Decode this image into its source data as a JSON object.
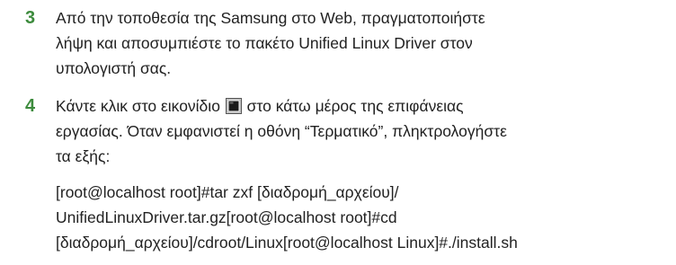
{
  "steps": [
    {
      "number": "3",
      "lines": [
        "Από την τοποθεσία της Samsung στο Web, πραγματοποιήστε",
        "λήψη και αποσυμπιέστε το πακέτο Unified Linux Driver στον",
        "υπολογιστή σας."
      ]
    },
    {
      "number": "4",
      "line1_before_icon": "Κάντε κλικ στο εικονίδιο ",
      "line1_after_icon": " στο κάτω μέρος της επιφάνειας",
      "icon": "terminal-icon",
      "lines_rest": [
        "εργασίας. Όταν εμφανιστεί η οθόνη “Τερματικό”, πληκτρολογήστε",
        "τα εξής:"
      ],
      "command_lines": [
        "[root@localhost root]#tar zxf [διαδρομή_αρχείου]/",
        "UnifiedLinuxDriver.tar.gz[root@localhost root]#cd",
        "[διαδρομή_αρχείου]/cdroot/Linux[root@localhost Linux]#./install.sh"
      ]
    }
  ]
}
